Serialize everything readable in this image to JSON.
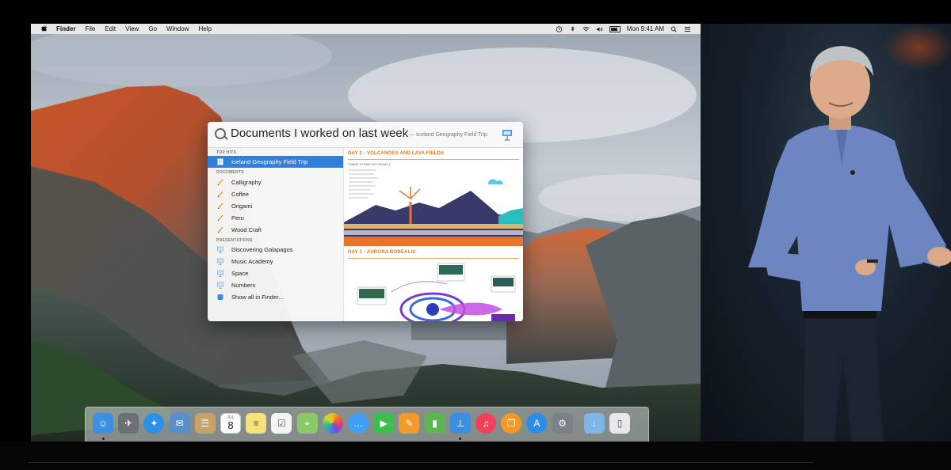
{
  "menubar": {
    "app_name": "Finder",
    "menus": [
      "File",
      "Edit",
      "View",
      "Go",
      "Window",
      "Help"
    ],
    "clock": "Mon 9:41 AM",
    "status_icons": [
      "time-machine-icon",
      "bluetooth-icon",
      "wifi-icon",
      "volume-icon",
      "battery-icon",
      "spotlight-icon",
      "notification-center-icon"
    ]
  },
  "spotlight": {
    "query": "Documents I worked on last week",
    "completion_hint": "— Iceland Geography Field Trip",
    "sections": {
      "top_hits": "TOP HITS",
      "documents": "DOCUMENTS",
      "presentations": "PRESENTATIONS"
    },
    "top_hit": "Iceland Geography Field Trip",
    "documents": [
      "Calligraphy",
      "Coffee",
      "Origami",
      "Peru",
      "Wood Craft"
    ],
    "presentations": [
      "Discovering Galapagos",
      "Music Academy",
      "Space",
      "Numbers"
    ],
    "show_all": "Show all in Finder...",
    "preview": {
      "heading_1": "DAY 2 - VOLCANOES AND LAVA FIELDS",
      "subheading_1": "THINGS TO FIND OUT ON DAY 2",
      "heading_2": "DAY 1 - AURORA BOREALIS"
    }
  },
  "dock": {
    "apps": [
      {
        "icon": "finder-icon",
        "color": "#3d8fe0"
      },
      {
        "icon": "launchpad-icon",
        "color": "#6b6f76"
      },
      {
        "icon": "safari-icon",
        "color": "#2c8fe8"
      },
      {
        "icon": "mail-icon",
        "color": "#5b8fc7"
      },
      {
        "icon": "contacts-icon",
        "color": "#c7a26a"
      },
      {
        "icon": "calendar-icon",
        "color": "#ffffff"
      },
      {
        "icon": "notes-icon",
        "color": "#f6e27a"
      },
      {
        "icon": "reminders-icon",
        "color": "#f4f4f4"
      },
      {
        "icon": "maps-icon",
        "color": "#8cc86b"
      },
      {
        "icon": "photos-icon",
        "color": "#ffffff"
      },
      {
        "icon": "messages-icon",
        "color": "#3fa1f5"
      },
      {
        "icon": "facetime-icon",
        "color": "#3ebd4f"
      },
      {
        "icon": "pages-icon",
        "color": "#f29a2e"
      },
      {
        "icon": "numbers-icon",
        "color": "#5ab552"
      },
      {
        "icon": "keynote-icon",
        "color": "#3a8fe0"
      },
      {
        "icon": "itunes-icon",
        "color": "#f0405a"
      },
      {
        "icon": "ibooks-icon",
        "color": "#f39a24"
      },
      {
        "icon": "app-store-icon",
        "color": "#2d8ce8"
      },
      {
        "icon": "system-preferences-icon",
        "color": "#7c8087"
      },
      {
        "icon": "downloads-folder-icon",
        "color": "#7fb6e6"
      },
      {
        "icon": "trash-icon",
        "color": "#e6e8ea"
      }
    ],
    "calendar_day": "8",
    "calendar_month": "JUL"
  }
}
